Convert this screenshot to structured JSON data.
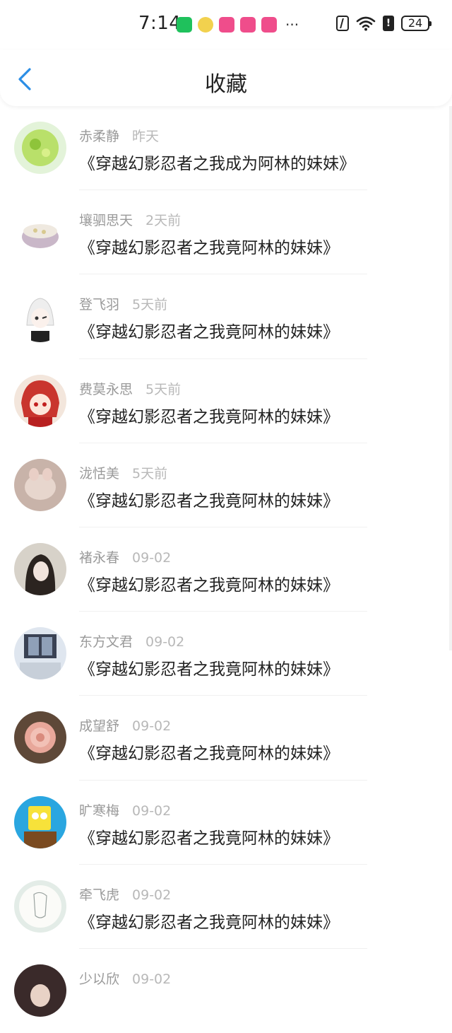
{
  "status_bar": {
    "time": "7:14",
    "more": "···",
    "battery": "24"
  },
  "header": {
    "title": "收藏"
  },
  "items": [
    {
      "user": "赤柔静",
      "time": "昨天",
      "title": "《穿越幻影忍者之我成为阿林的妹妹》",
      "avatar_color": "#b9e06a"
    },
    {
      "user": "壤驷思天",
      "time": "2天前",
      "title": "《穿越幻影忍者之我竟阿林的妹妹》",
      "avatar_color": "#c9b7c8"
    },
    {
      "user": "登飞羽",
      "time": "5天前",
      "title": "《穿越幻影忍者之我竟阿林的妹妹》",
      "avatar_color": "#eeeeee"
    },
    {
      "user": "费莫永思",
      "time": "5天前",
      "title": "《穿越幻影忍者之我竟阿林的妹妹》",
      "avatar_color": "#c9352e"
    },
    {
      "user": "泷恬美",
      "time": "5天前",
      "title": "《穿越幻影忍者之我竟阿林的妹妹》",
      "avatar_color": "#c8b3a9"
    },
    {
      "user": "褚永春",
      "time": "09-02",
      "title": "《穿越幻影忍者之我竟阿林的妹妹》",
      "avatar_color": "#d7d2c9"
    },
    {
      "user": "东方文君",
      "time": "09-02",
      "title": "《穿越幻影忍者之我竟阿林的妹妹》",
      "avatar_color": "#dfe6ef"
    },
    {
      "user": "成望舒",
      "time": "09-02",
      "title": "《穿越幻影忍者之我竟阿林的妹妹》",
      "avatar_color": "#e8a79a"
    },
    {
      "user": "旷寒梅",
      "time": "09-02",
      "title": "《穿越幻影忍者之我竟阿林的妹妹》",
      "avatar_color": "#2aa6e0"
    },
    {
      "user": "牵飞虎",
      "time": "09-02",
      "title": "《穿越幻影忍者之我竟阿林的妹妹》",
      "avatar_color": "#e3ece7"
    },
    {
      "user": "少以欣",
      "time": "09-02",
      "title": "",
      "avatar_color": "#3a2a2a"
    }
  ]
}
